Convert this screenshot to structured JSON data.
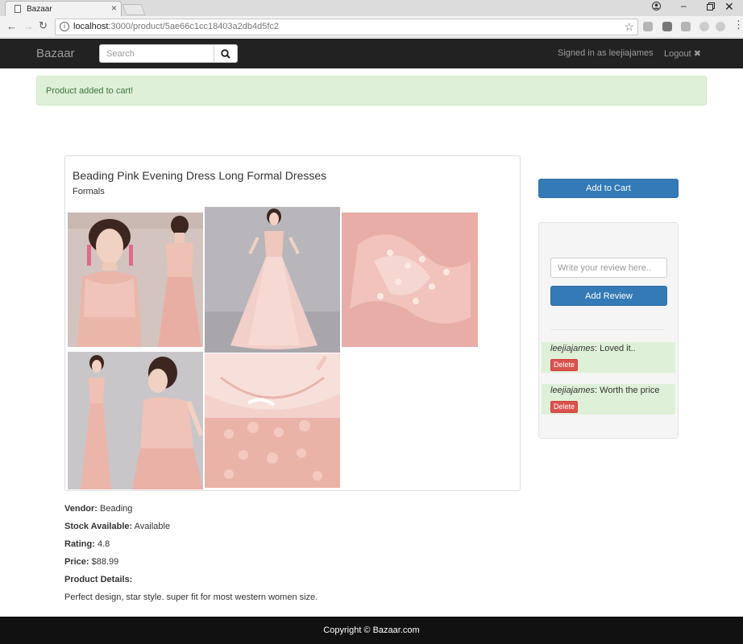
{
  "browser": {
    "tab_title": "Bazaar",
    "url_host": "localhost",
    "url_rest": ":3000/product/5ae66c1cc18403a2db4d5fc2"
  },
  "navbar": {
    "brand": "Bazaar",
    "search_placeholder": "Search",
    "signed_in_text": "Signed in as leejiajames",
    "logout_label": "Logout ✖"
  },
  "alert": {
    "message": "Product added to cart!"
  },
  "product": {
    "title": "Beading Pink Evening Dress Long Formal Dresses",
    "category": "Formals",
    "images": [
      {
        "name": "product-photo-front-back"
      },
      {
        "name": "product-photo-full-gown"
      },
      {
        "name": "product-photo-lace-closeup"
      },
      {
        "name": "product-photo-model-pose"
      },
      {
        "name": "product-photo-neckline-closeup"
      }
    ],
    "details": {
      "vendor_label": "Vendor:",
      "vendor": "Beading",
      "stock_label": "Stock Available:",
      "stock": "Available",
      "rating_label": "Rating:",
      "rating": "4.8",
      "price_label": "Price:",
      "price": "$88.99",
      "details_label": "Product Details:",
      "description": "Perfect design, star style. super fit for most western women size."
    }
  },
  "sidebar": {
    "add_to_cart_label": "Add to Cart",
    "review_placeholder": "Write your review here..",
    "add_review_label": "Add Review",
    "reviews": [
      {
        "author": "leejiajames",
        "text": ": Loved it..",
        "delete_label": "Delete"
      },
      {
        "author": "leejiajames",
        "text": ": Worth the price",
        "delete_label": "Delete"
      }
    ]
  },
  "footer": {
    "copyright": "Copyright © Bazaar.com"
  },
  "colors": {
    "navbar_bg": "#222222",
    "primary": "#337ab7",
    "danger": "#d9534f",
    "success_bg": "#dff0d8",
    "footer_bg": "#111111"
  }
}
